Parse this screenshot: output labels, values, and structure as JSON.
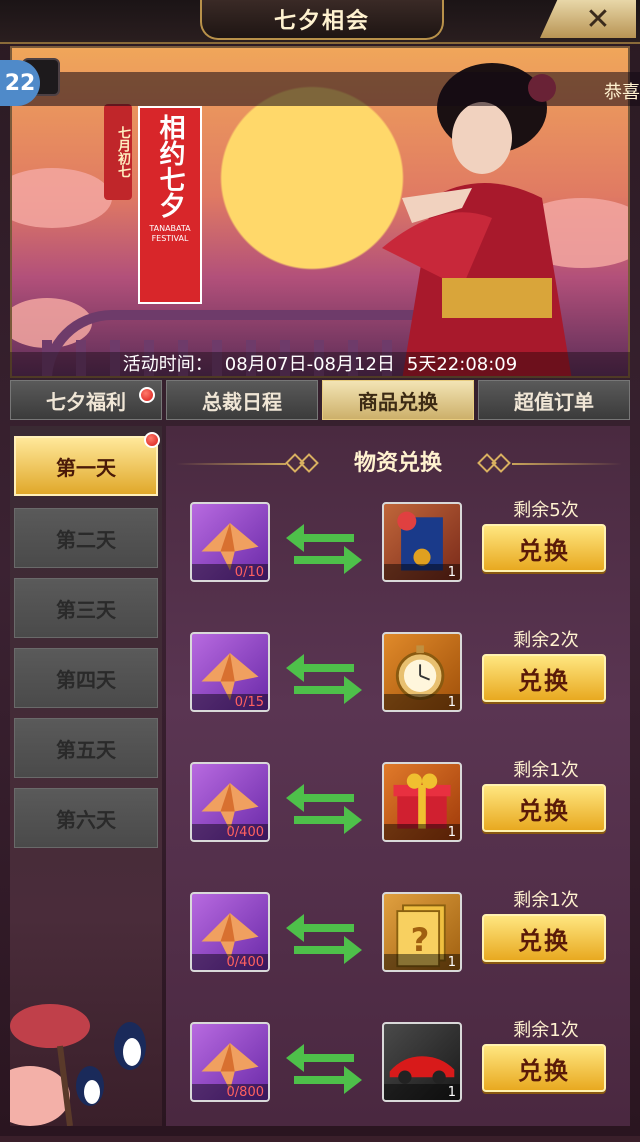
{
  "header": {
    "title": "七夕相会",
    "close_label": "✕"
  },
  "banner": {
    "badge": "22",
    "marquee_text": "恭喜",
    "poster_title": "相约七夕",
    "poster_sub": "TANABATA FESTIVAL",
    "date_tag": "七月初七",
    "activity_label": "活动时间：",
    "activity_range": "08月07日-08月12日",
    "countdown": "5天22:08:09"
  },
  "tabs": [
    {
      "label": "七夕福利",
      "active": false,
      "dot": true
    },
    {
      "label": "总裁日程",
      "active": false,
      "dot": false
    },
    {
      "label": "商品兑换",
      "active": true,
      "dot": false
    },
    {
      "label": "超值订单",
      "active": false,
      "dot": false
    }
  ],
  "days": [
    {
      "label": "第一天",
      "active": true,
      "dot": true
    },
    {
      "label": "第二天",
      "active": false
    },
    {
      "label": "第三天",
      "active": false
    },
    {
      "label": "第四天",
      "active": false
    },
    {
      "label": "第五天",
      "active": false
    },
    {
      "label": "第六天",
      "active": false
    }
  ],
  "section_title": "物资兑换",
  "exchanges": [
    {
      "cost": "0/10",
      "reward_qty": "1",
      "reward_icon": "document-seal-icon",
      "remaining": "剩余5次",
      "button": "兑换"
    },
    {
      "cost": "0/15",
      "reward_qty": "1",
      "reward_icon": "pocket-watch-icon",
      "remaining": "剩余2次",
      "button": "兑换"
    },
    {
      "cost": "0/400",
      "reward_qty": "1",
      "reward_icon": "gift-box-icon",
      "remaining": "剩余1次",
      "button": "兑换"
    },
    {
      "cost": "0/400",
      "reward_qty": "1",
      "reward_icon": "mystery-card-icon",
      "remaining": "剩余1次",
      "button": "兑换"
    },
    {
      "cost": "0/800",
      "reward_qty": "1",
      "reward_icon": "red-sports-car-icon",
      "remaining": "剩余1次",
      "button": "兑换"
    }
  ],
  "colors": {
    "gold": "#e8a920",
    "active_tab": "#cdb06a",
    "red": "#d81a1a"
  }
}
